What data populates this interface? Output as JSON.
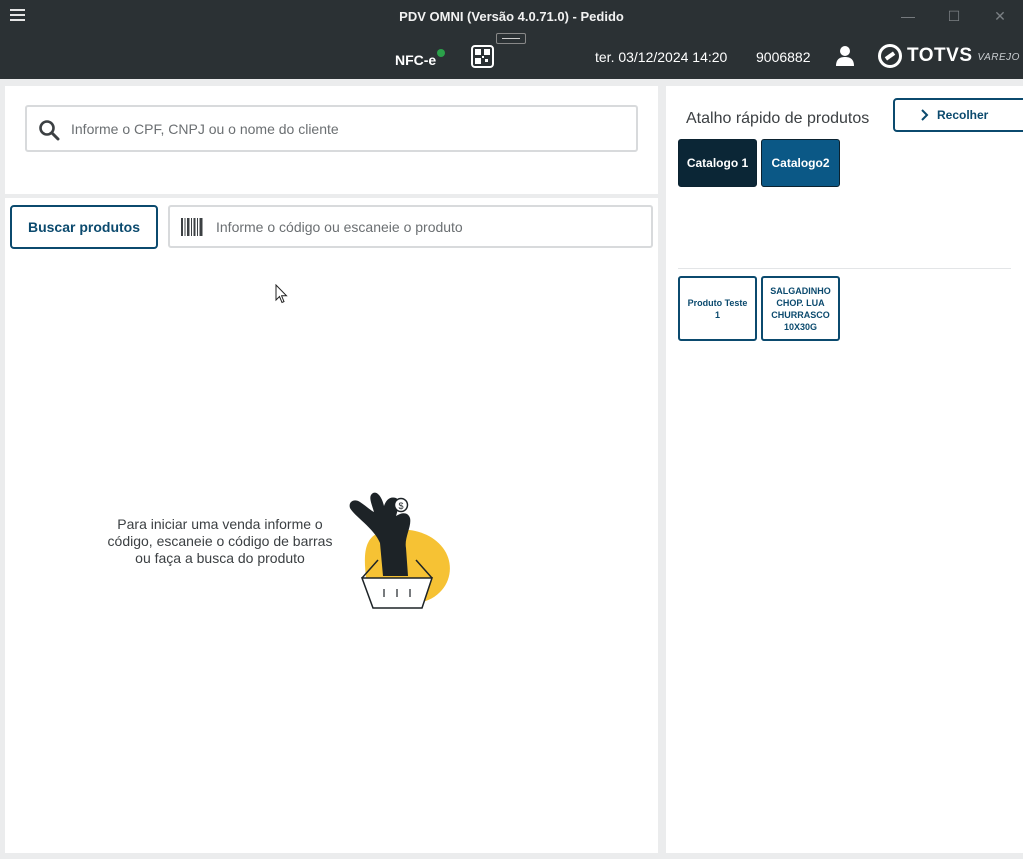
{
  "window": {
    "title": "PDV OMNI (Versão 4.0.71.0) - Pedido",
    "controls": [
      "minimize",
      "maximize",
      "close"
    ]
  },
  "header": {
    "nfce_label": "NFC-e",
    "nfce_status_color": "#2ba14a",
    "datetime": "ter. 03/12/2024 14:20",
    "operator_code": "9006882",
    "brand_name": "TOTVS",
    "brand_sub": "VAREJO"
  },
  "client": {
    "search_placeholder": "Informe o CPF, CNPJ ou o nome do cliente",
    "search_value": ""
  },
  "products": {
    "search_button": "Buscar produtos",
    "code_placeholder": "Informe o código ou escaneie o produto",
    "code_value": "",
    "empty_message": "Para iniciar uma venda informe o código, escaneie o código de barras ou faça a busca do produto"
  },
  "shortcuts": {
    "title": "Atalho rápido de produtos",
    "collapse_button": "Recolher",
    "catalogs": [
      {
        "label": "Catalogo 1",
        "color": "#0b2636"
      },
      {
        "label": "Catalogo2",
        "color": "#0b5886"
      }
    ],
    "items": [
      {
        "label": "Produto Teste 1"
      },
      {
        "label": "SALGADINHO CHOP. LUA CHURRASCO 10X30G"
      }
    ]
  },
  "theme": {
    "titlebar_bg": "#2b3134",
    "accent": "#0b4a6e",
    "illustration_yellow": "#f6c234"
  }
}
